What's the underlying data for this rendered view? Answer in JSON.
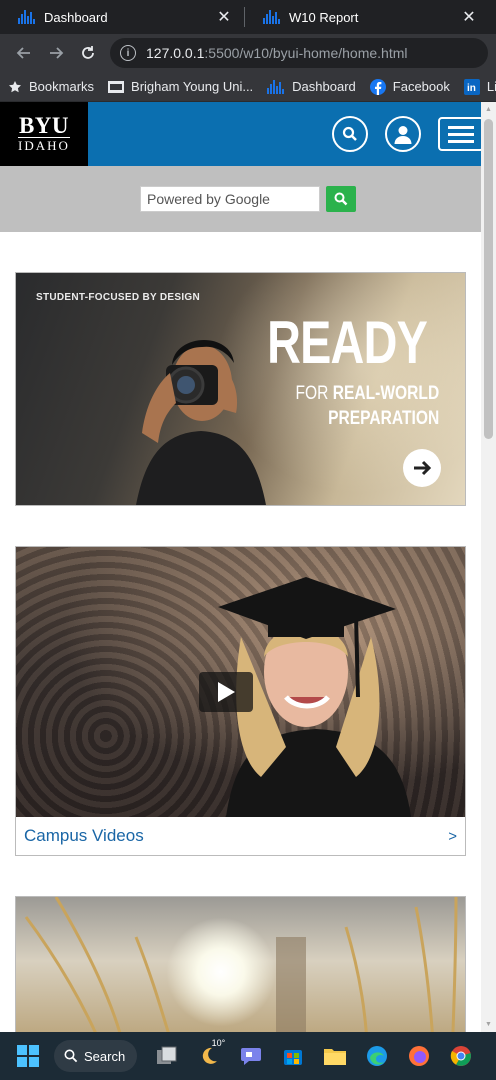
{
  "browser": {
    "tabs": [
      {
        "title": "Dashboard",
        "close": "✕"
      },
      {
        "title": "W10 Report",
        "close": "✕"
      }
    ],
    "address": {
      "host": "127.0.0.1",
      "path": ":5500/w10/byui-home/home.html"
    },
    "bookmarks": [
      {
        "label": "Bookmarks",
        "icon": "star-icon"
      },
      {
        "label": "Brigham Young Uni...",
        "icon": "byu-icon"
      },
      {
        "label": "Dashboard",
        "icon": "bars-chart-icon"
      },
      {
        "label": "Facebook",
        "icon": "facebook-icon"
      },
      {
        "label": "Link",
        "icon": "linkedin-icon"
      }
    ]
  },
  "site": {
    "logo": {
      "line1": "BYU",
      "line2": "IDAHO"
    },
    "search": {
      "placeholder": "Powered by Google"
    },
    "hero": {
      "eyebrow": "STUDENT-FOCUSED BY DESIGN",
      "headline": "READY",
      "sub_line1_prefix": "FOR ",
      "sub_line1_bold": "REAL-WORLD",
      "sub_line2": "PREPARATION"
    },
    "video_card": {
      "caption": "Campus Videos",
      "chevron": ">"
    }
  },
  "taskbar": {
    "search_label": "Search",
    "weather_temp": "10°"
  },
  "colors": {
    "brand_blue": "#0b6fb0",
    "search_green": "#2bb24c",
    "link_blue": "#1a66a6"
  }
}
